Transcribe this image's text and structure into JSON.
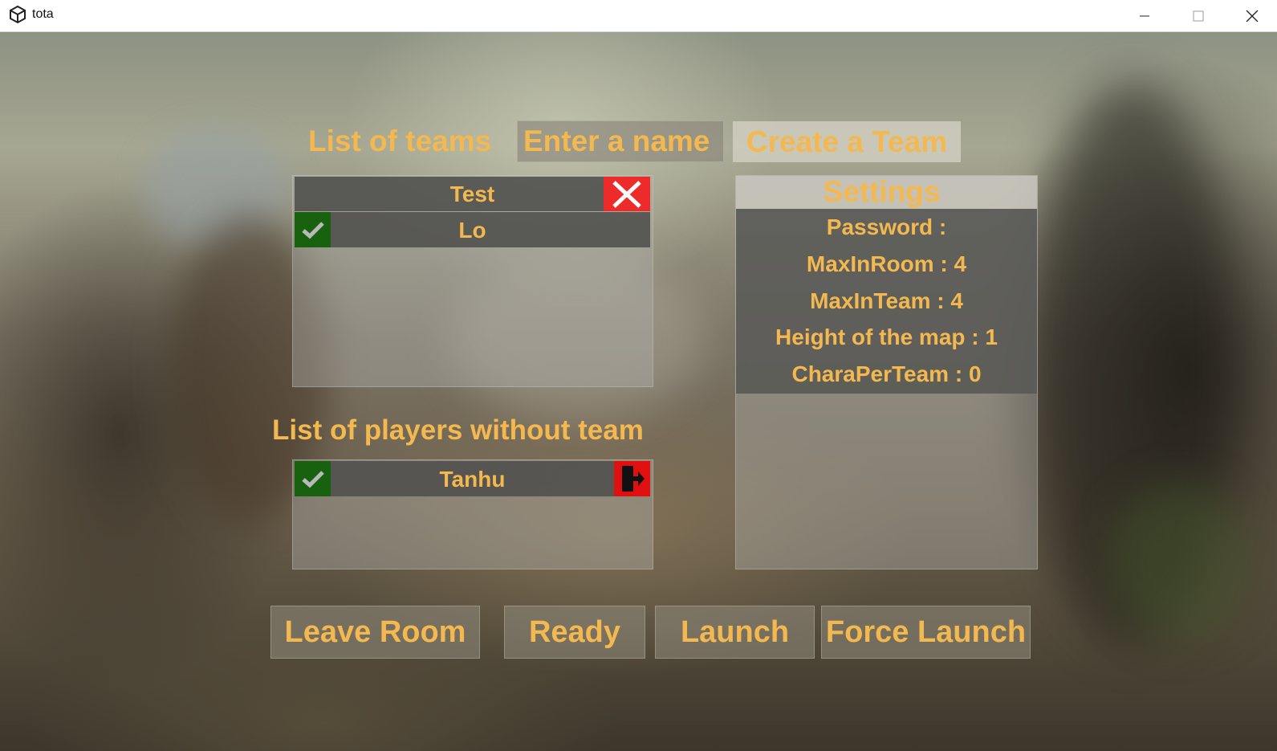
{
  "window": {
    "title": "tota"
  },
  "teams_header": {
    "title": "List of teams",
    "name_input_placeholder": "Enter a name",
    "create_button": "Create a Team"
  },
  "teams": [
    {
      "name": "Test",
      "members": [
        {
          "name": "Lo",
          "ready": true
        }
      ]
    }
  ],
  "players_without_team": {
    "title": "List of players without team",
    "players": [
      {
        "name": "Tanhu",
        "ready": true
      }
    ]
  },
  "settings": {
    "title": "Settings",
    "lines": [
      "Password :",
      "MaxInRoom : 4",
      "MaxInTeam : 4",
      "Height of the map : 1",
      "CharaPerTeam : 0"
    ]
  },
  "actions": {
    "leave_room": "Leave Room",
    "ready": "Ready",
    "launch": "Launch",
    "force_launch": "Force Launch"
  },
  "colors": {
    "accent_text": "#f3b84f",
    "ready_green": "#17610f",
    "delete_red": "#ee2b2b",
    "leave_red": "#e01010"
  }
}
